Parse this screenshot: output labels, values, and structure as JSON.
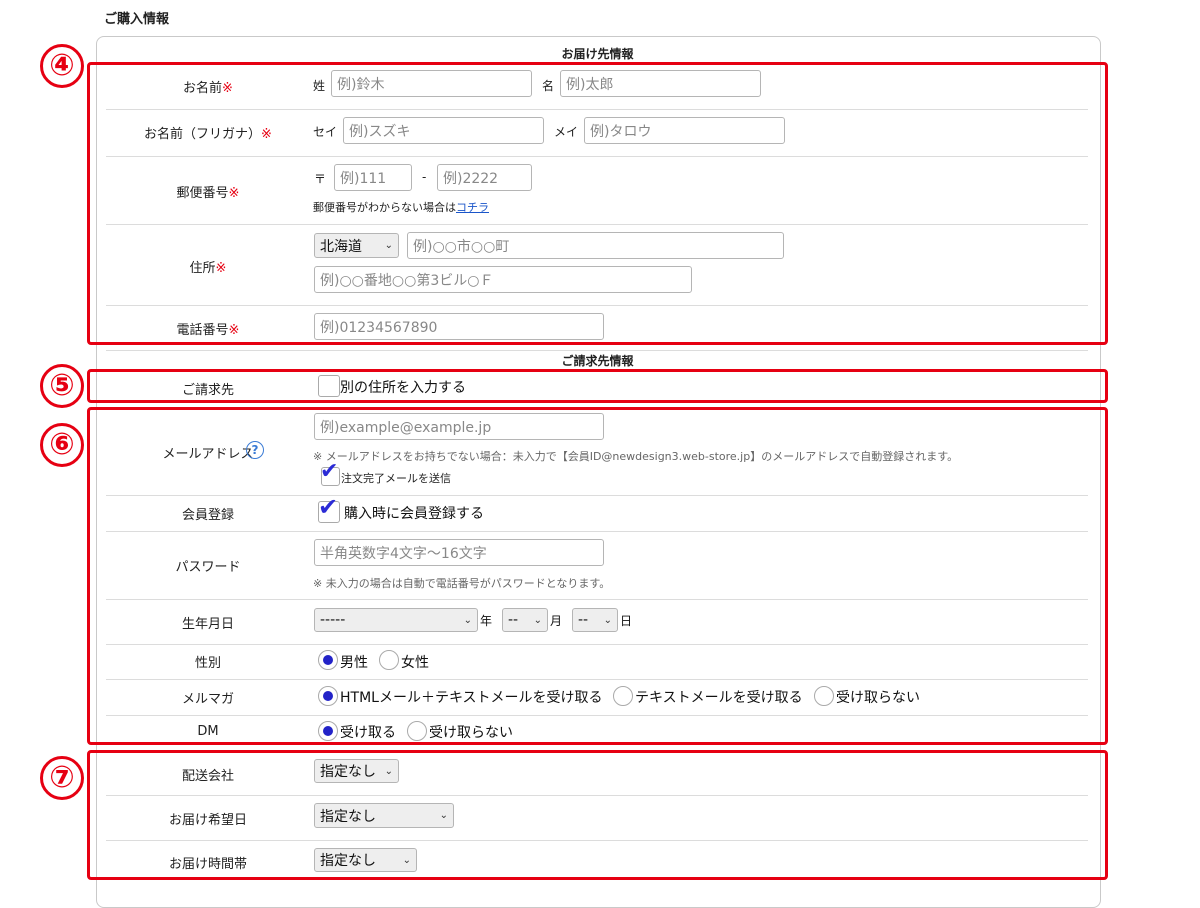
{
  "page_title": "ご購入情報",
  "sections": {
    "delivery_title": "お届け先情報",
    "billing_title": "ご請求先情報"
  },
  "markers": [
    "④",
    "⑤",
    "⑥",
    "⑦"
  ],
  "required_mark": "※",
  "name": {
    "label": "お名前",
    "last_prefix": "姓",
    "last_placeholder": "例)鈴木",
    "first_prefix": "名",
    "first_placeholder": "例)太郎"
  },
  "kana": {
    "label": "お名前（フリガナ）",
    "last_prefix": "セイ",
    "last_placeholder": "例)スズキ",
    "first_prefix": "メイ",
    "first_placeholder": "例)タロウ"
  },
  "postal": {
    "label": "郵便番号",
    "symbol": "〒",
    "part1_placeholder": "例)111",
    "dash": "-",
    "part2_placeholder": "例)2222",
    "help_text": "郵便番号がわからない場合は",
    "help_link": "コチラ"
  },
  "address": {
    "label": "住所",
    "prefecture": "北海道",
    "city_placeholder": "例)○○市○○町",
    "street_placeholder": "例)○○番地○○第3ビル○Ｆ"
  },
  "phone": {
    "label": "電話番号",
    "placeholder": "例)01234567890"
  },
  "billing": {
    "label": "ご請求先",
    "checkbox_label": "別の住所を入力する",
    "checked": false
  },
  "email": {
    "label": "メールアドレス",
    "help_icon": "question-circle-icon",
    "placeholder": "例)example@example.jp",
    "note": "※ メールアドレスをお持ちでない場合：未入力で【会員ID@newdesign3.web-store.jp】のメールアドレスで自動登録されます。",
    "send_mail_label": "注文完了メールを送信",
    "send_mail_checked": true
  },
  "member": {
    "label": "会員登録",
    "checkbox_label": "購入時に会員登録する",
    "checked": true
  },
  "password": {
    "label": "パスワード",
    "placeholder": "半角英数字4文字〜16文字",
    "note": "※ 未入力の場合は自動で電話番号がパスワードとなります。"
  },
  "birthday": {
    "label": "生年月日",
    "year_value": "-----",
    "year_unit": "年",
    "month_value": "--",
    "month_unit": "月",
    "day_value": "--",
    "day_unit": "日"
  },
  "gender": {
    "label": "性別",
    "options": [
      "男性",
      "女性"
    ],
    "selected": 0
  },
  "mailmag": {
    "label": "メルマガ",
    "options": [
      "HTMLメール＋テキストメールを受け取る",
      "テキストメールを受け取る",
      "受け取らない"
    ],
    "selected": 0
  },
  "dm": {
    "label": "DM",
    "options": [
      "受け取る",
      "受け取らない"
    ],
    "selected": 0
  },
  "shipping_company": {
    "label": "配送会社",
    "value": "指定なし"
  },
  "delivery_date": {
    "label": "お届け希望日",
    "value": "指定なし"
  },
  "delivery_time": {
    "label": "お届け時間帯",
    "value": "指定なし"
  },
  "colors": {
    "accent_red": "#e60012",
    "radio_blue": "#2323c8",
    "link_blue": "#1a55c9"
  }
}
